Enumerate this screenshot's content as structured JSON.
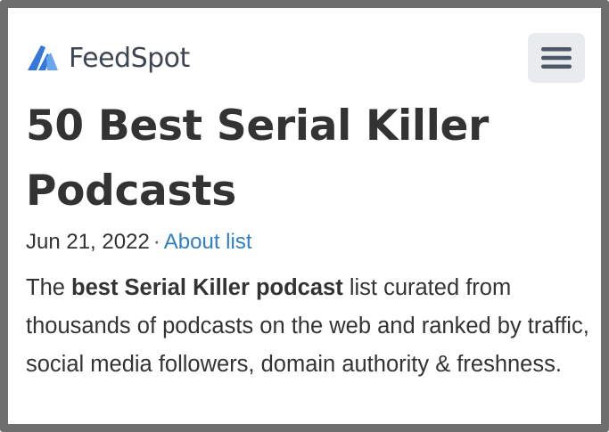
{
  "header": {
    "logo_text": "FeedSpot",
    "logo_icon": "feedspot-logo-icon",
    "menu_icon": "hamburger-menu-icon",
    "colors": {
      "logo_blue_dark": "#3478d9",
      "logo_blue_light": "#6aa6ee",
      "logo_text": "#3d4652",
      "menu_bg": "#e9ebef",
      "menu_bars": "#4a5868"
    }
  },
  "article": {
    "title": "50 Best Serial Killer Podcasts",
    "date": "Jun 21, 2022",
    "separator": "·",
    "about_link": "About list",
    "description_prefix": "The ",
    "description_bold": "best Serial Killer podcast",
    "description_suffix": " list curated from thousands of podcasts on the web and ranked by traffic, social media followers, domain authority & freshness.",
    "colors": {
      "text": "#333333",
      "link": "#2f7fc1"
    }
  }
}
